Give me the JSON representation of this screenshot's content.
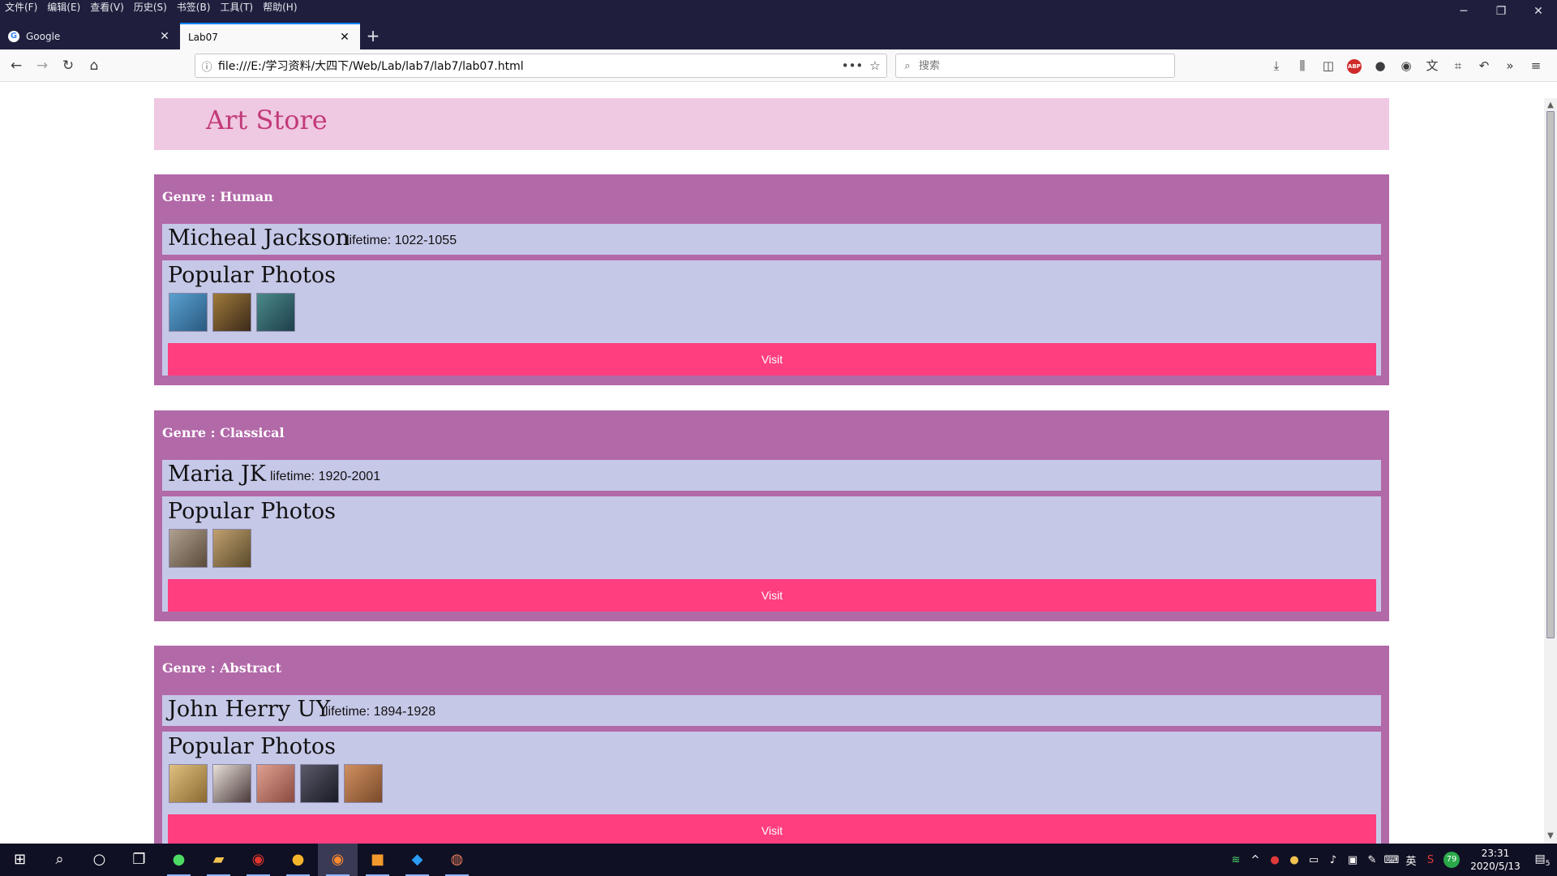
{
  "menu": [
    "文件(F)",
    "编辑(E)",
    "查看(V)",
    "历史(S)",
    "书签(B)",
    "工具(T)",
    "帮助(H)"
  ],
  "tabs": [
    {
      "title": "Google",
      "active": false
    },
    {
      "title": "Lab07",
      "active": true
    }
  ],
  "address": {
    "url": "file:///E:/学习资料/大四下/Web/Lab/lab7/lab7/lab07.html"
  },
  "search": {
    "placeholder": "搜索"
  },
  "page": {
    "store_title": "Art Store",
    "photos_heading": "Popular Photos",
    "visit_label": "Visit",
    "genres": [
      {
        "title": "Genre : Human",
        "artist": "Micheal Jackson",
        "lifetime": "lifetime: 1022-1055",
        "photos": [
          "#3d7fb0",
          "#7a5a2a",
          "#2f6a6a"
        ]
      },
      {
        "title": "Genre : Classical",
        "artist": "Maria JK",
        "lifetime": "lifetime: 1920-2001",
        "photos": [
          "#8a7a6a",
          "#9a7a4a"
        ]
      },
      {
        "title": "Genre : Abstract",
        "artist": "John Herry UY",
        "lifetime": "lifetime: 1894-1928",
        "photos": [
          "#c0a060",
          "#6a6060",
          "#c07a6a",
          "#3a3a4a",
          "#b07050"
        ]
      }
    ]
  },
  "taskbar": {
    "time": "23:31",
    "date": "2020/5/13",
    "ime": "英",
    "badge": "79",
    "notif_count": "5"
  },
  "colors": {
    "header_bg": "#efc8e1",
    "header_text": "#c23a7a",
    "genre_bg": "#b269a8",
    "panel_bg": "#c6c8e8",
    "visit_bg": "#ff3e7f"
  }
}
